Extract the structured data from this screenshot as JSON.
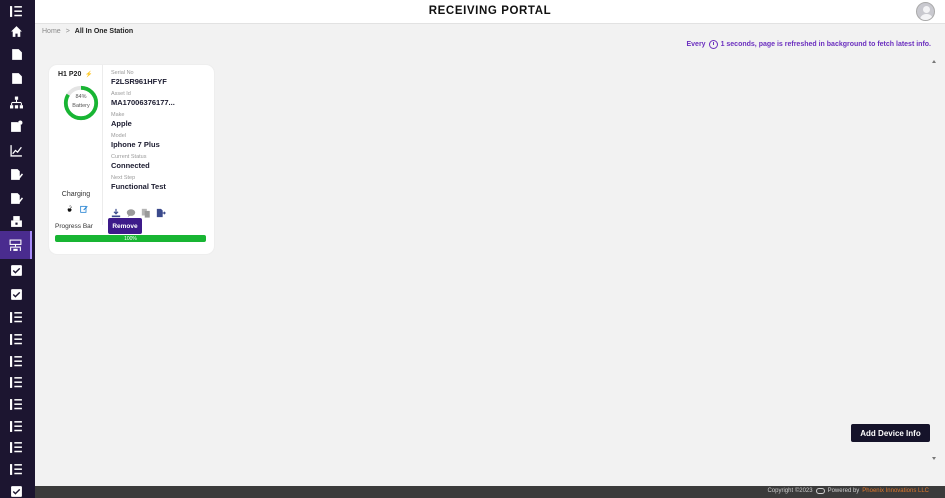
{
  "app": {
    "title": "RECEIVING PORTAL"
  },
  "breadcrumb": {
    "home": "Home",
    "separator": ">",
    "current": "All In One Station"
  },
  "refresh_note": {
    "prefix": "Every",
    "suffix": "1 seconds, page is refreshed in background to fetch latest info."
  },
  "sidebar": {
    "items": [
      {
        "icon": "list-icon"
      },
      {
        "icon": "home-icon"
      },
      {
        "icon": "document-icon"
      },
      {
        "icon": "document-icon"
      },
      {
        "icon": "hierarchy-icon"
      },
      {
        "icon": "document-settings-icon"
      },
      {
        "icon": "chart-line-icon"
      },
      {
        "icon": "edit-document-icon"
      },
      {
        "icon": "edit-document-icon"
      },
      {
        "icon": "inventory-icon"
      },
      {
        "icon": "station-icon",
        "active": true
      },
      {
        "icon": "checklist-icon"
      },
      {
        "icon": "checklist-icon"
      },
      {
        "icon": "list-icon"
      },
      {
        "icon": "list-icon"
      },
      {
        "icon": "list-icon"
      },
      {
        "icon": "list-icon"
      },
      {
        "icon": "list-icon"
      },
      {
        "icon": "list-icon"
      },
      {
        "icon": "list-icon"
      },
      {
        "icon": "list-icon"
      },
      {
        "icon": "checklist-icon"
      }
    ]
  },
  "device_card": {
    "name": "H1 P20",
    "battery_percent_text": "84%",
    "battery_label": "Battery",
    "battery_level": 0.84,
    "charging_text": "Charging",
    "remove_label": "Remove",
    "fields": [
      {
        "label": "Serial No",
        "value": "F2LSR961HFYF"
      },
      {
        "label": "Asset Id",
        "value": "MA17006376177..."
      },
      {
        "label": "Make",
        "value": "Apple"
      },
      {
        "label": "Model",
        "value": "Iphone 7 Plus"
      },
      {
        "label": "Current Status",
        "value": "Connected"
      },
      {
        "label": "Next Step",
        "value": "Functional Test"
      }
    ],
    "progress_label": "Progress Bar",
    "progress_text": "100%",
    "progress_value": 1.0
  },
  "actions": {
    "add_device_label": "Add Device Info"
  },
  "footer": {
    "copyright": "Copyright ©2023",
    "powered_by": "Powered by",
    "company": "Phoenix Innovations LLC"
  },
  "colors": {
    "sidebar_bg": "#1c1530",
    "accent_purple": "#3d1a8a",
    "battery_green": "#18b533",
    "refresh_note": "#6b2fbf",
    "footer_link": "#e0782c"
  }
}
